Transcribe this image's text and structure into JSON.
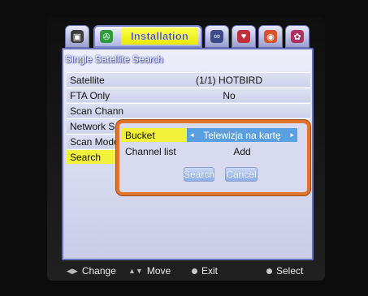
{
  "tabs": [
    {
      "icon": "satellite-dish-icon",
      "glyph": "▣"
    },
    {
      "icon": "tools-icon",
      "glyph": "✇",
      "label": "Installation",
      "active": true
    },
    {
      "icon": "glasses-icon",
      "glyph": "∞"
    },
    {
      "icon": "heart-icon",
      "glyph": "♥"
    },
    {
      "icon": "disc-icon",
      "glyph": "◉"
    },
    {
      "icon": "gear-icon",
      "glyph": "✿"
    }
  ],
  "panel": {
    "title": "Single Satellite Search",
    "rows": [
      {
        "label": "Satellite",
        "value": "(1/1) HOTBIRD"
      },
      {
        "label": "FTA Only",
        "value": "No"
      },
      {
        "label": "Scan Chann",
        "value": ""
      },
      {
        "label": "Network Se",
        "value": ""
      },
      {
        "label": "Scan Mode",
        "value": ""
      },
      {
        "label": "Search",
        "value": "",
        "selected": true
      }
    ]
  },
  "dialog": {
    "bucket_label": "Bucket",
    "bucket_value": "Telewizja na kartę",
    "channel_list_label": "Channel list",
    "channel_list_value": "Add",
    "search_button": "Search",
    "cancel_button": "Cancel"
  },
  "footer": {
    "change": "Change",
    "move": "Move",
    "exit": "Exit",
    "select": "Select"
  },
  "colors": {
    "highlight": "#f2f23a",
    "dialog_border": "#e0742c",
    "panel_border": "#6a72bd",
    "selector_blue": "#5aa0e0"
  }
}
